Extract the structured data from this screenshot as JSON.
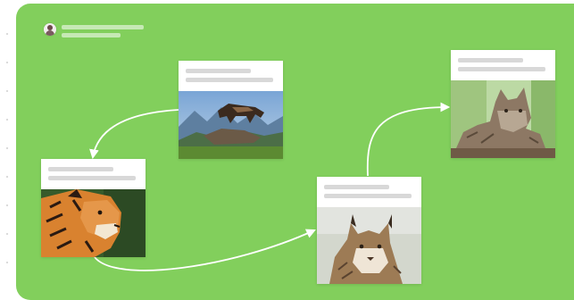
{
  "colors": {
    "page_background": "#ffffff",
    "canvas_background": "#82cf5c",
    "connector": "#ffffff",
    "card_background": "#ffffff",
    "placeholder_line": "#d8d8d8"
  },
  "header": {
    "avatar_icon": "user-avatar-icon"
  },
  "nodes": [
    {
      "id": "wolf",
      "image_icon": "wolf-on-rock-photo"
    },
    {
      "id": "tiger",
      "image_icon": "tiger-portrait-photo"
    },
    {
      "id": "lynx",
      "image_icon": "lynx-portrait-photo"
    },
    {
      "id": "maine-coon",
      "image_icon": "maine-coon-cat-photo"
    }
  ],
  "edges": [
    {
      "from": "wolf",
      "to": "tiger"
    },
    {
      "from": "tiger",
      "to": "lynx"
    },
    {
      "from": "lynx",
      "to": "maine-coon"
    }
  ]
}
